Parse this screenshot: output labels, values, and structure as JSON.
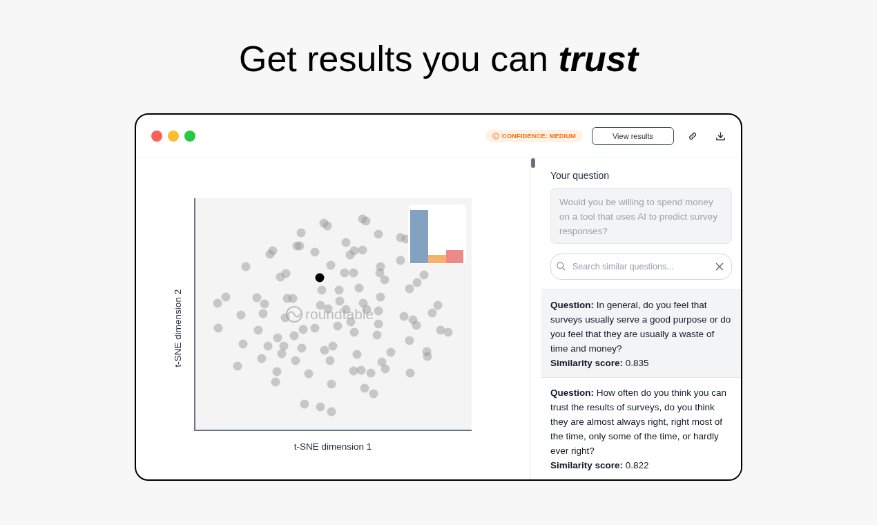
{
  "headline": "Get results you can **trust**",
  "toolbar": {
    "badge": "CONFIDENCE: MEDIUM",
    "button": "View results"
  },
  "plot": {
    "xlabel": "t-SNE dimension 1",
    "ylabel": "t-SNE dimension 2",
    "logo_text": "roundtable"
  },
  "question": {
    "label": "Your question",
    "value": "Would you be willing to spend money on a tool that uses AI to predict survey responses?"
  },
  "search": {
    "placeholder": "Search similar questions..."
  },
  "results": [
    {
      "question_label": "Question:",
      "question": "In general, do you feel that surveys usually serve a good purpose or do you feel that they are usually a waste of time and money?",
      "score_label": "Similarity score:",
      "score": "0.835",
      "selected": true
    },
    {
      "question_label": "Question:",
      "question": "How often do you think you can trust the results of surveys, do you think they are almost always right, right most of the time, only some of the time, or hardly ever right?",
      "score_label": "Similarity score:",
      "score": "0.822",
      "selected": false
    }
  ]
}
